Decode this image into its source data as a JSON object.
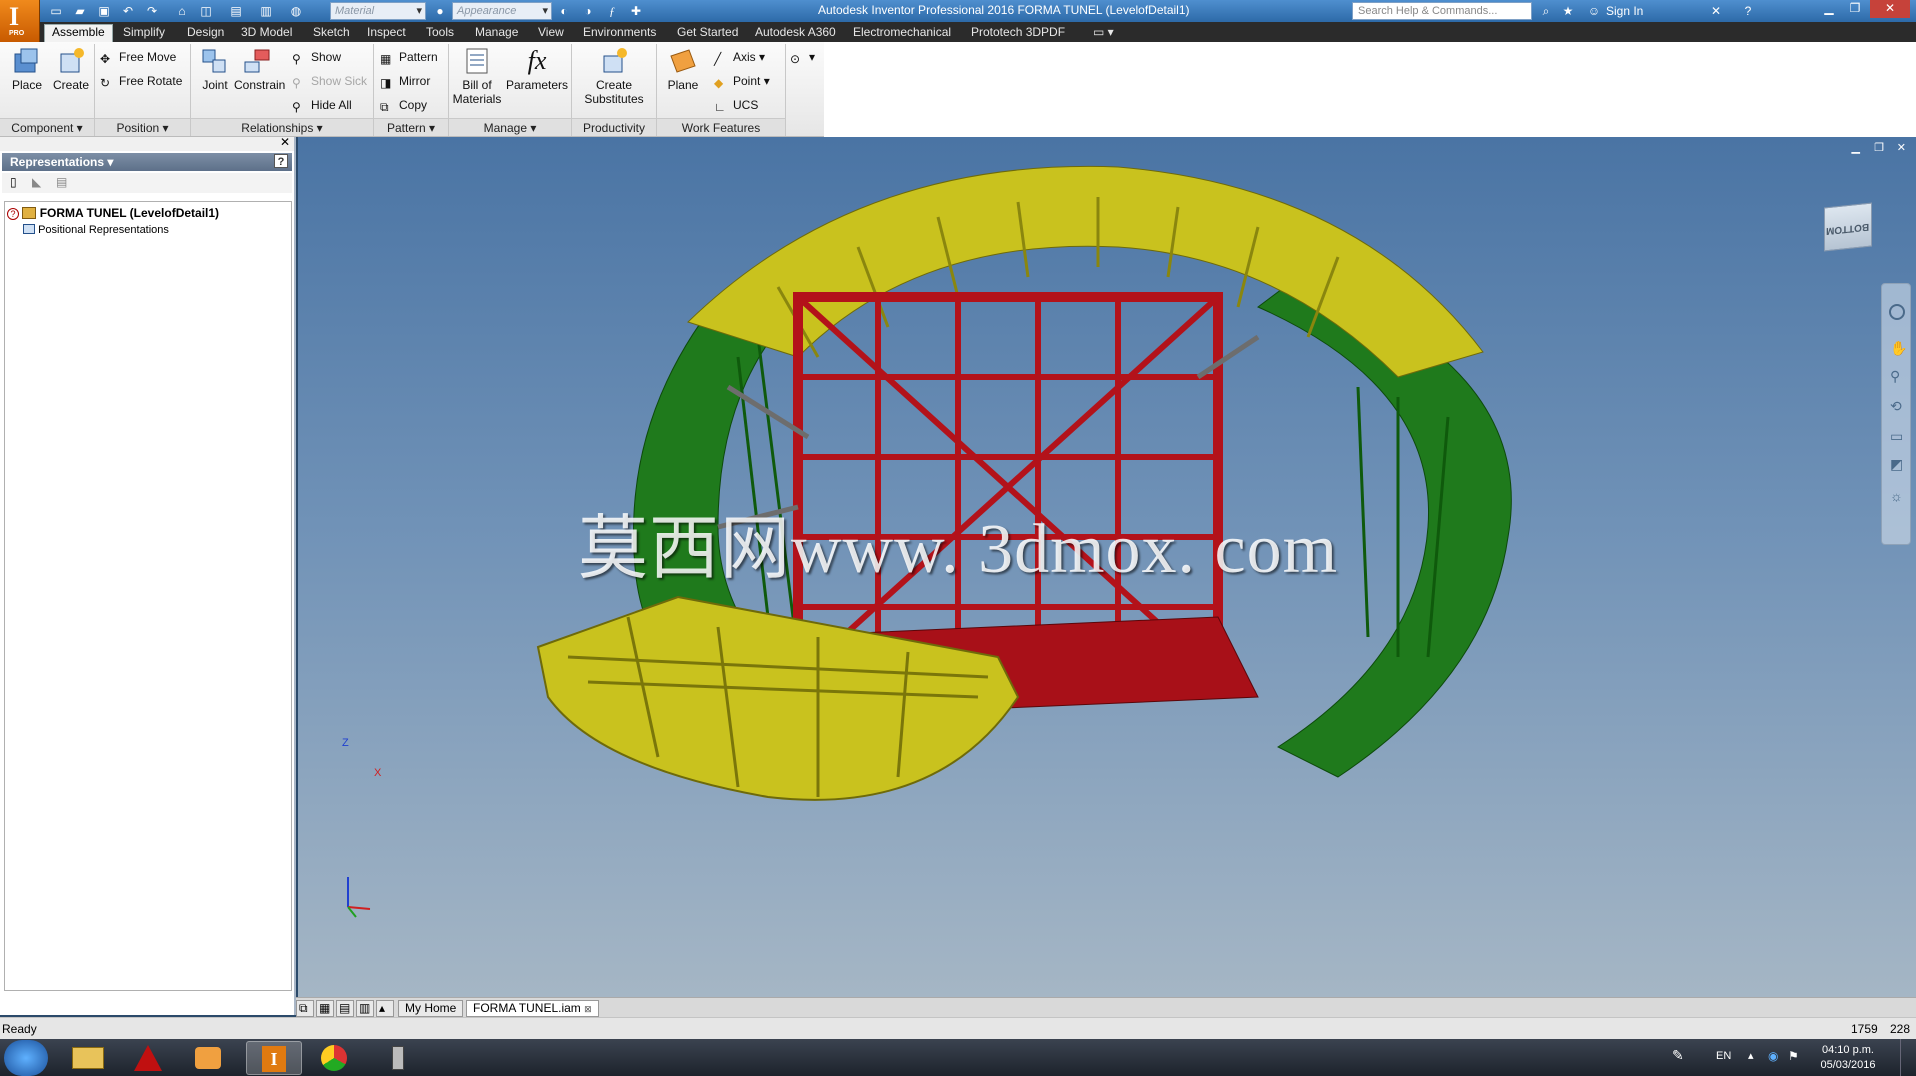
{
  "titlebar": {
    "title": "Autodesk Inventor Professional 2016    FORMA TUNEL (LevelofDetail1)",
    "material_placeholder": "Material",
    "appearance_placeholder": "Appearance",
    "search_placeholder": "Search Help & Commands...",
    "sign_in": "Sign In",
    "logo_letter": "I",
    "logo_badge": "PRO"
  },
  "ribbon_tabs": [
    "Assemble",
    "Simplify",
    "Design",
    "3D Model",
    "Sketch",
    "Inspect",
    "Tools",
    "Manage",
    "View",
    "Environments",
    "Get Started",
    "Autodesk A360",
    "Electromechanical",
    "Prototech 3DPDF"
  ],
  "ribbon": {
    "component": {
      "title": "Component",
      "place": "Place",
      "create": "Create"
    },
    "position": {
      "title": "Position",
      "free_move": "Free Move",
      "free_rotate": "Free Rotate"
    },
    "relationships": {
      "title": "Relationships",
      "joint": "Joint",
      "constrain": "Constrain",
      "show": "Show",
      "show_sick": "Show Sick",
      "hide_all": "Hide All"
    },
    "pattern": {
      "title": "Pattern",
      "pattern": "Pattern",
      "mirror": "Mirror",
      "copy": "Copy"
    },
    "manage": {
      "title": "Manage",
      "bom_line1": "Bill of",
      "bom_line2": "Materials",
      "parameters": "Parameters"
    },
    "productivity": {
      "title": "Productivity",
      "create_line1": "Create",
      "create_line2": "Substitutes"
    },
    "work_features": {
      "title": "Work Features",
      "plane": "Plane",
      "axis": "Axis",
      "point": "Point",
      "ucs": "UCS"
    }
  },
  "browser": {
    "header": "Representations",
    "root_item": "FORMA TUNEL (LevelofDetail1)",
    "child_item": "Positional Representations"
  },
  "viewport": {
    "watermark": "莫西网www. 3dmox. com",
    "viewcube_label": "BOTTOM",
    "axis_z": "Z",
    "axis_x": "X"
  },
  "doc_tabs": [
    "My Home",
    "FORMA TUNEL.iam"
  ],
  "status": {
    "text": "Ready",
    "count1": "1759",
    "count2": "228"
  },
  "taskbar": {
    "lang": "EN",
    "time": "04:10 p.m.",
    "date": "05/03/2016"
  },
  "colors": {
    "green": "#1f7a1c",
    "yellow": "#c9c21e",
    "red": "#b3121a",
    "ribbon_bg": "#efefef"
  }
}
